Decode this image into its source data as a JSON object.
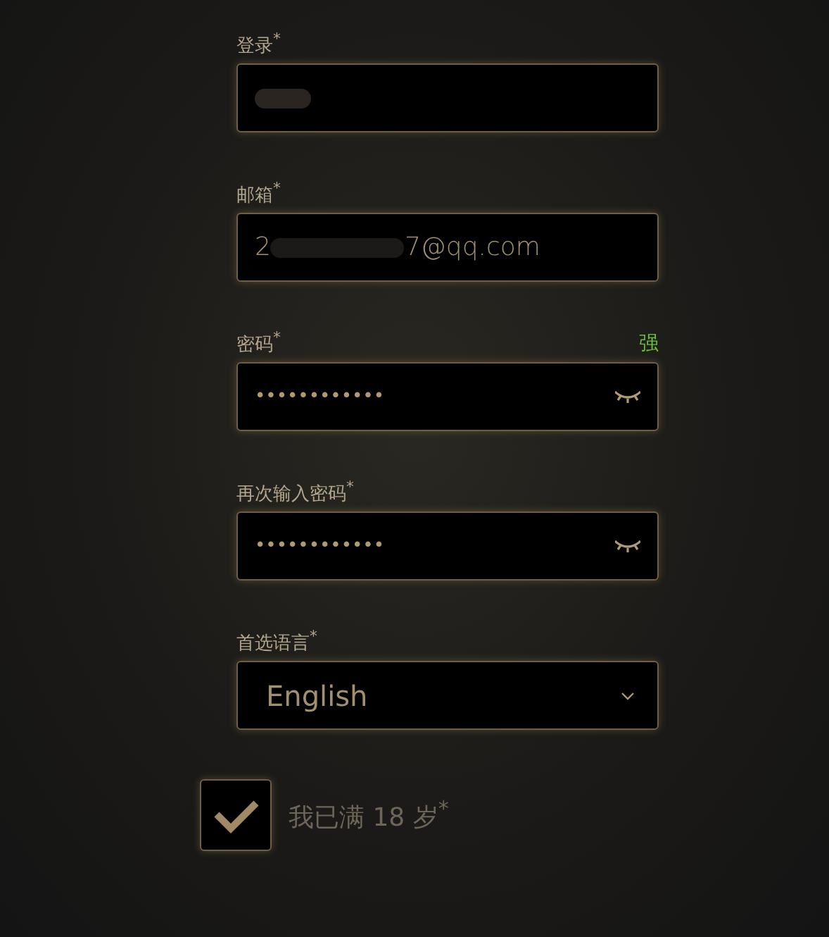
{
  "fields": [
    {
      "kind": "text",
      "label": "登录$^{*}$",
      "redacted": true
    },
    {
      "kind": "text",
      "label": "邮箱$^{*}$",
      "value_start": "2",
      "redacted": true,
      "value_end": "7@qq.com"
    },
    {
      "kind": "password",
      "label": "密码$^{*}$",
      "strength": "强",
      "value": "••••••••••••"
    },
    {
      "kind": "password",
      "label": "再次输入密码$^{*}$",
      "value": "••••••••••••"
    },
    {
      "kind": "select",
      "label": "首选语言$^{*}$",
      "value": "English"
    }
  ],
  "age_check": {
    "label": "我已满 18 岁$^{*}$",
    "checked": true
  }
}
